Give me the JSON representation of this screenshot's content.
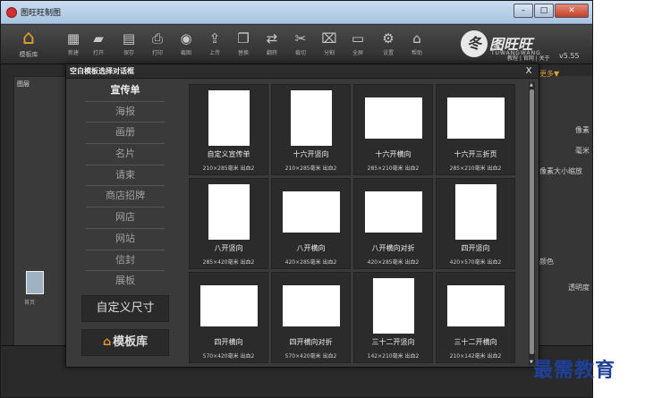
{
  "window": {
    "title": "图旺旺制图",
    "controls": [
      "–",
      "□",
      "✕"
    ]
  },
  "toolbar": {
    "home_label": "模板库",
    "tools": [
      {
        "name": "new",
        "label": "新建",
        "glyph": "▦"
      },
      {
        "name": "open",
        "label": "打开",
        "glyph": "▰"
      },
      {
        "name": "save",
        "label": "保存",
        "glyph": "▤"
      },
      {
        "name": "print",
        "label": "打印",
        "glyph": "⎙"
      },
      {
        "name": "screenshot",
        "label": "截图",
        "glyph": "◉"
      },
      {
        "name": "upload",
        "label": "上传",
        "glyph": "⇪"
      },
      {
        "name": "copy",
        "label": "替换",
        "glyph": "❐"
      },
      {
        "name": "swap",
        "label": "翻转",
        "glyph": "⇄"
      },
      {
        "name": "cut",
        "label": "裁切",
        "glyph": "✂"
      },
      {
        "name": "split",
        "label": "分割",
        "glyph": "⌧"
      },
      {
        "name": "screen",
        "label": "全屏",
        "glyph": "▭"
      },
      {
        "name": "settings",
        "label": "设置",
        "glyph": "⚙"
      },
      {
        "name": "help",
        "label": "帮助",
        "glyph": "⌂"
      }
    ],
    "top_links": "教程 | 官网 | 关于",
    "brand_mark": "冬",
    "brand_name": "图旺旺",
    "brand_sub": "TUWANGWANG",
    "version": "v5.55"
  },
  "left_panel": {
    "label": "图层",
    "sheet_label": "首页"
  },
  "right_panel": {
    "items": [
      "像素",
      "毫米",
      "像素大小缩放",
      "颜色",
      "透明度"
    ],
    "link": "更多▼"
  },
  "dialog": {
    "title": "空白模板选择对话框",
    "close": "X",
    "categories": [
      "宣传单",
      "海报",
      "画册",
      "名片",
      "请柬",
      "商店招牌",
      "网店",
      "网站",
      "信封",
      "展板"
    ],
    "custom_size": "自定义尺寸",
    "library": "模板库",
    "templates": [
      {
        "name": "自定义宣传单",
        "size": "210×285毫米 出血2",
        "orientation": "portrait"
      },
      {
        "name": "十六开竖向",
        "size": "210×285毫米 出血2",
        "orientation": "portrait"
      },
      {
        "name": "十六开横向",
        "size": "285×210毫米 出血2",
        "orientation": "landscape"
      },
      {
        "name": "十六开三折页",
        "size": "285×210毫米 出血2",
        "orientation": "landscape"
      },
      {
        "name": "八开竖向",
        "size": "285×420毫米 出血2",
        "orientation": "portrait"
      },
      {
        "name": "八开横向",
        "size": "420×285毫米 出血2",
        "orientation": "landscape"
      },
      {
        "name": "八开横向对折",
        "size": "420×285毫米 出血2",
        "orientation": "landscape"
      },
      {
        "name": "四开竖向",
        "size": "420×570毫米 出血2",
        "orientation": "portrait"
      },
      {
        "name": "四开横向",
        "size": "570×420毫米 出血2",
        "orientation": "landscape"
      },
      {
        "name": "四开横向对折",
        "size": "570×420毫米 出血2",
        "orientation": "landscape"
      },
      {
        "name": "三十二开竖向",
        "size": "142×210毫米 出血2",
        "orientation": "portrait"
      },
      {
        "name": "三十二开横向",
        "size": "210×142毫米 出血2",
        "orientation": "landscape"
      }
    ]
  },
  "watermark": "最需教育",
  "colors": {
    "accent": "#e0a030",
    "watermark": "#1f3f99"
  }
}
